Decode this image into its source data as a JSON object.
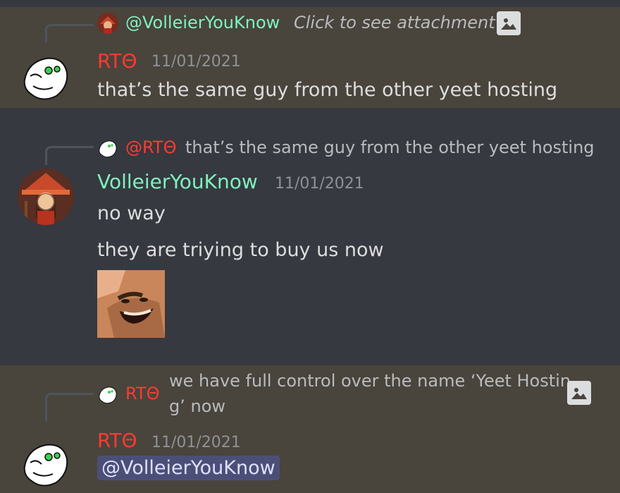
{
  "colors": {
    "background": "#36393f",
    "highlight_background": "#49443c",
    "rto_name": "#ff3b30",
    "volleier_name": "#7ef2c0",
    "timestamp": "#8e9297",
    "mention_background": "#4b4f78"
  },
  "messages": [
    {
      "reply": {
        "mention": "@VolleierYouKnow",
        "text": "Click to see attachment",
        "icon": "image-icon"
      },
      "author": "RTΘ",
      "timestamp": "11/01/2021",
      "lines": [
        "that’s the same guy from the other yeet hosting"
      ]
    },
    {
      "reply": {
        "mention": "@RTΘ",
        "text": "that’s the same guy from the other yeet hosting"
      },
      "author": "VolleierYouKnow",
      "timestamp": "11/01/2021",
      "lines": [
        "no way",
        "they are triying to buy us now"
      ],
      "emote": "laughing-man-emote"
    },
    {
      "reply": {
        "mention": "RTΘ",
        "text_line1": "we have full control over the name ‘Yeet Hostin",
        "text_line2": "g’ now",
        "icon": "image-icon"
      },
      "author": "RTΘ",
      "timestamp": "11/01/2021",
      "mention": "@VolleierYouKnow"
    }
  ]
}
